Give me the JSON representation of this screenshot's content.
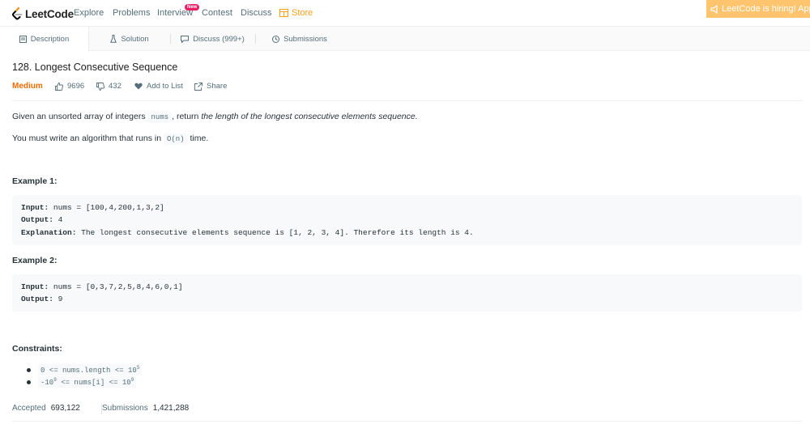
{
  "nav": {
    "logo_text": "LeetCode",
    "links": [
      "Explore",
      "Problems",
      "Interview",
      "Contest",
      "Discuss"
    ],
    "new_badge": "New",
    "store": "Store",
    "hiring": "LeetCode is hiring! Apply NOW."
  },
  "tabs": [
    "Description",
    "Solution",
    "Discuss (999+)",
    "Submissions"
  ],
  "problem": {
    "title": "128. Longest Consecutive Sequence",
    "difficulty": "Medium",
    "likes": "9696",
    "dislikes": "432",
    "add_to_list": "Add to List",
    "share": "Share"
  },
  "description": {
    "p1_before": "Given an unsorted array of integers ",
    "p1_code": "nums",
    "p1_middle": ", return ",
    "p1_em": "the length of the longest consecutive elements sequence.",
    "p2_before": "You must write an algorithm that runs in ",
    "p2_code": "O(n)",
    "p2_after": " time."
  },
  "examples": [
    {
      "title": "Example 1:",
      "input_label": "Input:",
      "input": " nums = [100,4,200,1,3,2]",
      "output_label": "Output:",
      "output": " 4",
      "explanation_label": "Explanation:",
      "explanation": " The longest consecutive elements sequence is [1, 2, 3, 4]. Therefore its length is 4."
    },
    {
      "title": "Example 2:",
      "input_label": "Input:",
      "input": " nums = [0,3,7,2,5,8,4,6,0,1]",
      "output_label": "Output:",
      "output": " 9"
    }
  ],
  "constraints": {
    "title": "Constraints:",
    "c1_text": "0 <= nums.length <= 10",
    "c1_sup": "5",
    "c2_pre": "-10",
    "c2_sup1": "9",
    "c2_mid": " <= nums[i] <= 10",
    "c2_sup2": "9"
  },
  "stats": {
    "accepted_label": "Accepted",
    "accepted": "693,122",
    "submissions_label": "Submissions",
    "submissions": "1,421,288"
  },
  "colors": {
    "brand": "#ffa116",
    "medium": "#ef6c00",
    "new_badge": "#e91e63",
    "hiring_bg": "#ffc46d"
  }
}
